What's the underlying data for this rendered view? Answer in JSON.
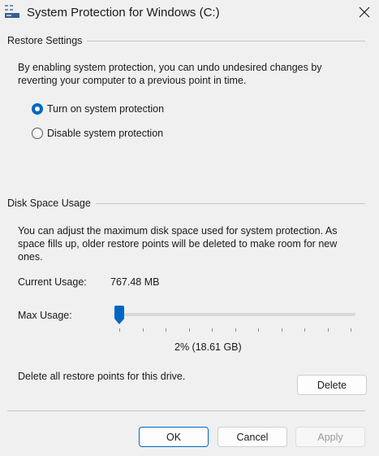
{
  "window": {
    "title": "System Protection for Windows (C:)",
    "close_glyph": "✕"
  },
  "restore_settings": {
    "heading": "Restore Settings",
    "description_line1": "By enabling system protection, you can undo undesired changes by",
    "description_line2": "reverting your computer to a previous point in time.",
    "options": [
      {
        "label": "Turn on system protection",
        "selected": true
      },
      {
        "label": "Disable system protection",
        "selected": false
      }
    ]
  },
  "disk_space": {
    "heading": "Disk Space Usage",
    "description_line1": "You can adjust the maximum disk space used for system protection. As",
    "description_line2": "space fills up, older restore points will be deleted to make room for new",
    "description_line3": "ones.",
    "current_usage_label": "Current Usage:",
    "current_usage_value": "767.48 MB",
    "max_usage_label": "Max Usage:",
    "max_usage_percent": 2,
    "max_usage_display": "2% (18.61 GB)",
    "delete_text": "Delete all restore points for this drive.",
    "delete_button": "Delete"
  },
  "footer": {
    "ok_label": "OK",
    "cancel_label": "Cancel",
    "apply_label": "Apply"
  },
  "icons": {
    "window_icon": "system-protection-icon",
    "close_icon": "close-icon"
  },
  "colors": {
    "accent": "#0067c0",
    "background": "#f0f0f0"
  }
}
